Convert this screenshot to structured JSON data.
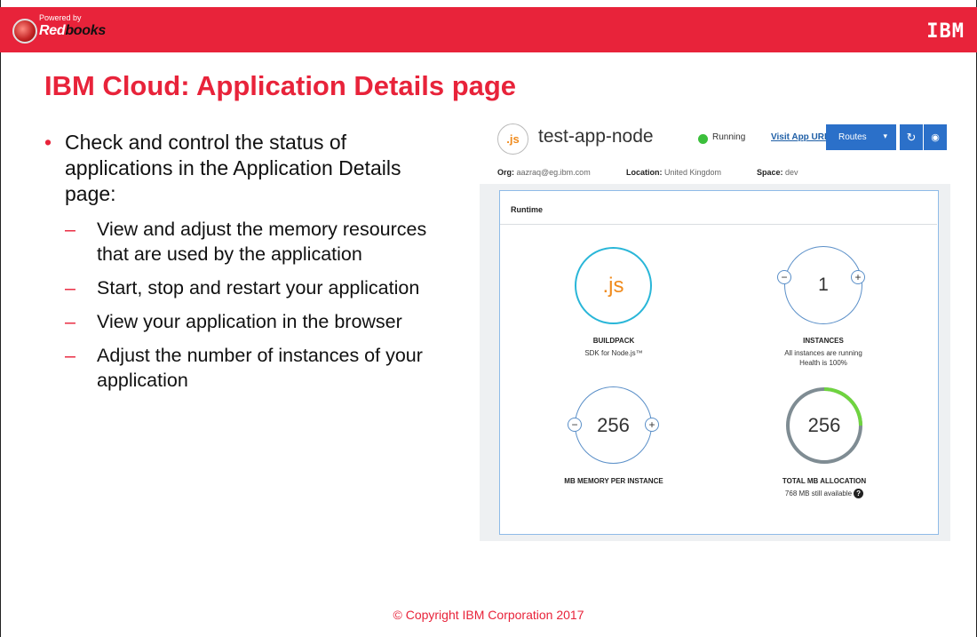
{
  "header": {
    "rb_powered": "Powered by",
    "rb_word_red": "Red",
    "rb_word_rest": "books",
    "ibm_logo": "IBM"
  },
  "slide": {
    "title": "IBM Cloud: Application Details page",
    "main_bullet": "Check and control the status of applications in the Application Details page:",
    "sub_bullets": [
      "View and adjust the memory resources that are used by the application",
      "Start, stop and restart your application",
      "View your application in the browser",
      "Adjust the number of instances of your application"
    ],
    "copyright": "© Copyright IBM Corporation 2017"
  },
  "app": {
    "icon_text": ".js",
    "name": "test-app-node",
    "status": "Running",
    "visit_link": "Visit App URL",
    "routes_label": "Routes",
    "restart_icon": "restart-icon",
    "stop_icon": "stop-icon",
    "meta": {
      "org_label": "Org:",
      "org_value": "aazraq@eg.ibm.com",
      "location_label": "Location:",
      "location_value": "United Kingdom",
      "space_label": "Space:",
      "space_value": "dev"
    },
    "runtime": {
      "title": "Runtime",
      "buildpack": {
        "icon_text": ".js",
        "label": "BUILDPACK",
        "sub": "SDK for Node.js™"
      },
      "instances": {
        "value": "1",
        "label": "INSTANCES",
        "sub1": "All instances are running",
        "sub2": "Health is 100%"
      },
      "memory": {
        "value": "256",
        "label": "MB MEMORY PER INSTANCE"
      },
      "total": {
        "value": "256",
        "label": "TOTAL MB ALLOCATION",
        "sub": "768 MB still available",
        "allocated_fraction": 0.25
      }
    },
    "colors": {
      "accent_red": "#e8233a",
      "primary_blue": "#2b70c9",
      "running_green": "#3bbf3b",
      "js_orange": "#f08b1d",
      "buildpack_ring": "#29b6d8"
    }
  }
}
